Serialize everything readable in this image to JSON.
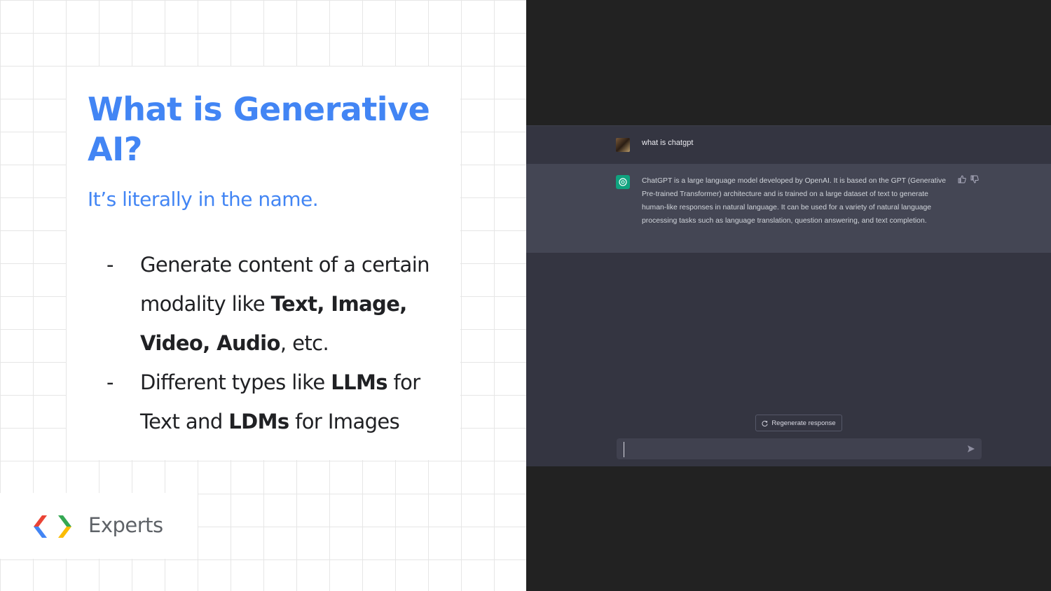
{
  "slide": {
    "title": "What is Generative AI?",
    "subtitle": "It’s literally in the name.",
    "bullets": [
      {
        "dash": "-",
        "parts": [
          {
            "text": "Generate content of a certain modality like ",
            "bold": false
          },
          {
            "text": "Text, Image, Video, Audio",
            "bold": true
          },
          {
            "text": ", etc.",
            "bold": false
          }
        ]
      },
      {
        "dash": "-",
        "parts": [
          {
            "text": "Different types like ",
            "bold": false
          },
          {
            "text": "LLMs",
            "bold": true
          },
          {
            "text": " for Text and ",
            "bold": false
          },
          {
            "text": "LDMs",
            "bold": true
          },
          {
            "text": " for Images",
            "bold": false
          }
        ]
      }
    ],
    "logo_text": "Experts",
    "colors": {
      "title": "#4285f4",
      "logo_blue": "#4285f4",
      "logo_red": "#ea4335",
      "logo_green": "#34a853",
      "logo_yellow": "#fbbc04"
    }
  },
  "chat": {
    "user_message": "what is chatgpt",
    "assistant_message": "ChatGPT is a large language model developed by OpenAI. It is based on the GPT (Generative Pre-trained Transformer) architecture and is trained on a large dataset of text to generate human-like responses in natural language. It can be used for a variety of natural language processing tasks such as language translation, question answering, and text completion.",
    "regenerate_label": "Regenerate response",
    "input_value": "",
    "icons": {
      "user_avatar": "user-avatar",
      "assistant_avatar": "openai-logo-icon",
      "thumbs_up": "thumbs-up-icon",
      "thumbs_down": "thumbs-down-icon",
      "regenerate": "refresh-icon",
      "send": "send-icon"
    },
    "colors": {
      "background": "#343541",
      "assistant_row": "#444654",
      "assistant_avatar": "#10a37f"
    }
  }
}
